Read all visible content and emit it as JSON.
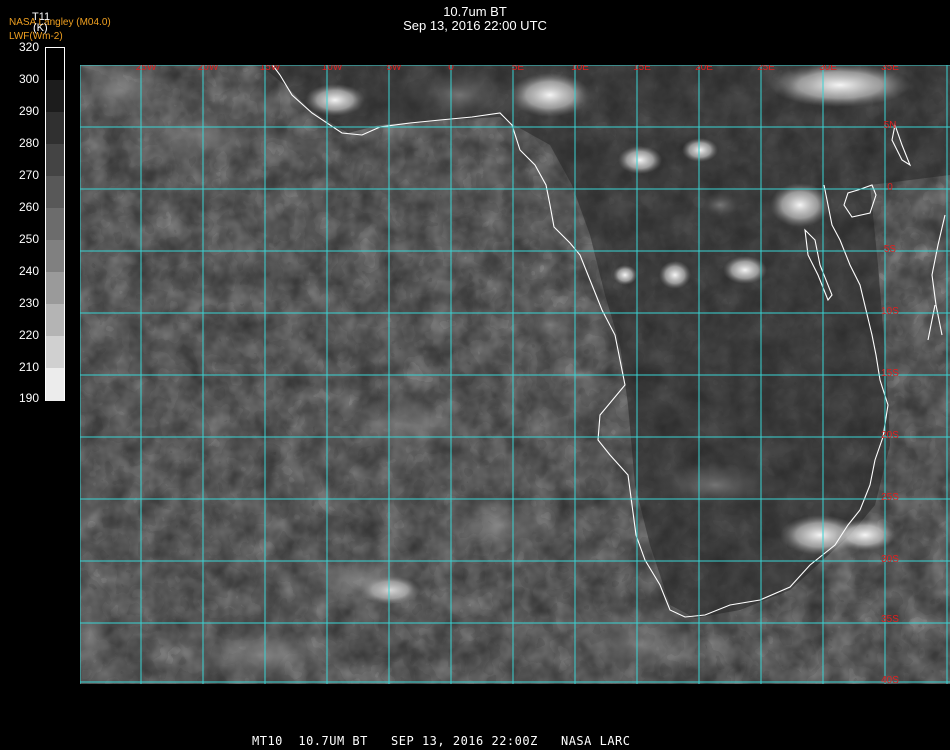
{
  "header": {
    "title": "10.7um BT",
    "subtitle": "Sep 13, 2016 22:00 UTC"
  },
  "source": {
    "line1": "NASA Langley (M04.0)",
    "line2": "LWF(Wm-2)"
  },
  "colorbar": {
    "title": "T11",
    "unit": "(K)",
    "labels": [
      "320",
      "300",
      "290",
      "280",
      "270",
      "260",
      "250",
      "240",
      "230",
      "220",
      "210",
      "190"
    ],
    "segment_colors": [
      "#000000",
      "#1c1c1c",
      "#303030",
      "#444444",
      "#585858",
      "#6c6c6c",
      "#808080",
      "#9a9a9a",
      "#b4b4b4",
      "#d0d0d0",
      "#ececec"
    ]
  },
  "map": {
    "lon_labels": [
      "25W",
      "20W",
      "15W",
      "10W",
      "5W",
      "0",
      "5E",
      "10E",
      "15E",
      "20E",
      "25E",
      "30E",
      "35E"
    ],
    "lat_labels": [
      "5N",
      "0",
      "5S",
      "10S",
      "15S",
      "20S",
      "25S",
      "30S",
      "35S",
      "40S"
    ],
    "grid_color": "#39d3d3",
    "label_color": "#e02020",
    "coast_color": "#ffffff"
  },
  "footer": {
    "text": "MT10  10.7UM BT   SEP 13, 2016 22:00Z   NASA LARC"
  }
}
